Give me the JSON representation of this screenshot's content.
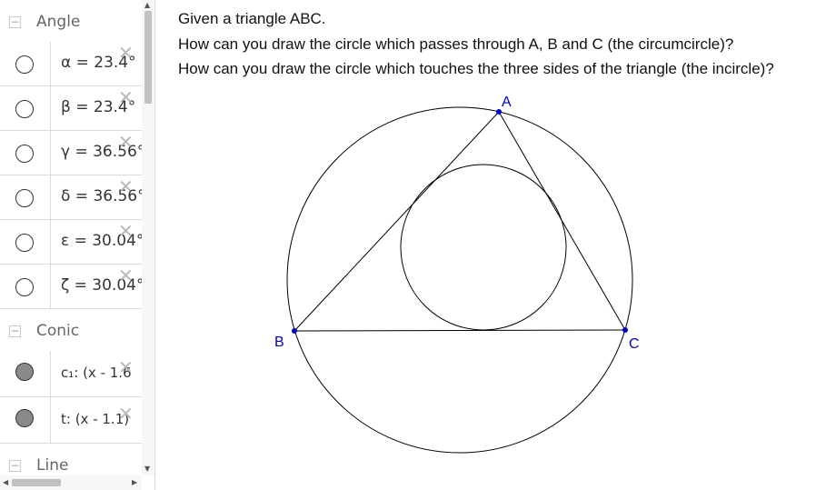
{
  "algebra": {
    "groups": [
      {
        "label": "Angle",
        "items": [
          {
            "def": "α = 23.4°",
            "filled": false
          },
          {
            "def": "β = 23.4°",
            "filled": false
          },
          {
            "def": "γ = 36.56°",
            "filled": false
          },
          {
            "def": "δ = 36.56°",
            "filled": false
          },
          {
            "def": "ε = 30.04°",
            "filled": false
          },
          {
            "def": "ζ = 30.04°",
            "filled": false
          }
        ]
      },
      {
        "label": "Conic",
        "items": [
          {
            "def": "c₁: (x - 1.6",
            "filled": true
          },
          {
            "def": "t: (x - 1.1)",
            "filled": true
          }
        ]
      },
      {
        "label": "Line",
        "items": []
      }
    ]
  },
  "text": {
    "line1": "Given a triangle ABC.",
    "line2": "How can you draw the circle which passes through A, B and C (the circumcircle)?",
    "line3": "How can you draw the circle which touches the three sides of the triangle (the incircle)?"
  },
  "graph": {
    "points": {
      "A": "A",
      "B": "B",
      "C": "C"
    },
    "point_color": "#0000cc",
    "line_color": "#000000"
  }
}
